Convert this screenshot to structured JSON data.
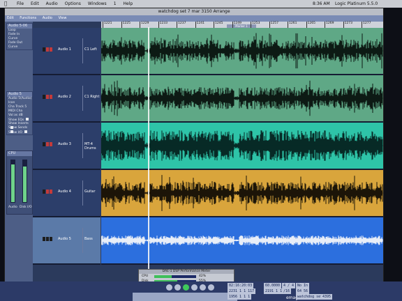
{
  "menubar": {
    "apple_glyph": "",
    "menus": [
      "File",
      "Edit",
      "Audio",
      "Options",
      "Windows",
      "1",
      "Help"
    ],
    "clock": "8:36 AM",
    "app_name": "Logic Platinum 5.5.0"
  },
  "window": {
    "title": "watchdog set 7 mar 3150 Arrange",
    "toolbar": [
      "Edit",
      "Functions",
      "Audio",
      "View"
    ]
  },
  "inspector": {
    "region_header": "Audio 5-06",
    "region_rows": [
      {
        "label": "Loop"
      },
      {
        "label": "Fade In"
      },
      {
        "label": "Curve"
      },
      {
        "label": "Fade Out"
      },
      {
        "label": "Curve"
      }
    ],
    "track_header": "Audio 5",
    "track_rows": [
      {
        "label": "Audio 5(Audio)"
      },
      {
        "label": "Icon"
      },
      {
        "label": "Cha",
        "value": "Track 5"
      },
      {
        "label": "MIDI Cha"
      },
      {
        "label": "Val as",
        "value": "dB"
      },
      {
        "label": "Show EQs",
        "checked": true
      },
      {
        "label": "Show Inserts",
        "checked": true
      },
      {
        "label": "Show Sends",
        "checked": true
      },
      {
        "label": "Show I/O",
        "checked": true
      }
    ],
    "meter_header": "CPU",
    "meters": [
      {
        "name": "Audio",
        "level": 0.9
      },
      {
        "name": "Disk I/O",
        "level": 0.85
      }
    ]
  },
  "tracks": [
    {
      "name": "Audio 1",
      "region": "C1 Left",
      "color": "#5fa886",
      "wave": "#0d1a14"
    },
    {
      "name": "Audio 2",
      "region": "C1 Right",
      "color": "#5fa886",
      "wave": "#0d1a14"
    },
    {
      "name": "Audio 3",
      "region": "MT-4 Drums",
      "color": "#2ec4a8",
      "wave": "#072a26"
    },
    {
      "name": "Audio 4",
      "region": "Guitar",
      "color": "#d9a53c",
      "wave": "#1c1508"
    },
    {
      "name": "Audio 5",
      "region": "Bass",
      "color": "#2c6fde",
      "wave": "#e8eef8"
    }
  ],
  "ruler": {
    "bars": [
      "1221",
      "1225",
      "1229",
      "1233",
      "1237",
      "1241",
      "1245",
      "1249",
      "1253",
      "1257",
      "1261",
      "1265",
      "1269",
      "1273",
      "1277"
    ],
    "marker_label": "Marker 1"
  },
  "performance_meter": {
    "title": "DAE-1 DSP Performance Meter",
    "rows": [
      {
        "label": "CPU",
        "level": 0.42,
        "value": "42%"
      },
      {
        "label": "Disk",
        "level": 0.55,
        "value": "55%"
      }
    ]
  },
  "transport": {
    "position_smpte": "02:16:20:03",
    "position_bars": "2231  1  1  117",
    "tempo": "60.0000",
    "signature": "4 / 4",
    "in_point": "1956  1  1  1",
    "out_point": "2191  1  1  1",
    "division": "/16",
    "logo": "emagic",
    "no_in": "No In",
    "no_out": "64  56",
    "song": "watchdog set",
    "extra": "4395"
  }
}
